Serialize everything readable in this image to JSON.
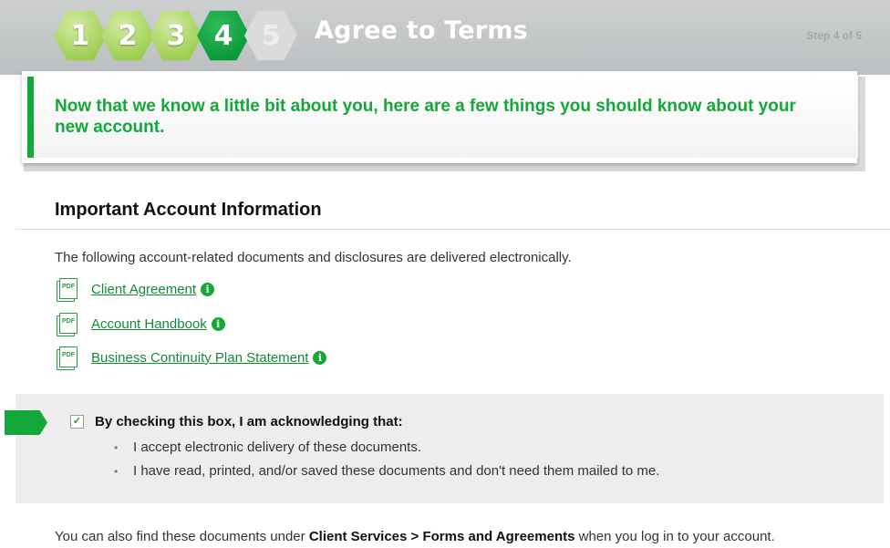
{
  "header": {
    "steps": [
      {
        "number": "1",
        "state": "done"
      },
      {
        "number": "2",
        "state": "done"
      },
      {
        "number": "3",
        "state": "done"
      },
      {
        "number": "4",
        "state": "current"
      },
      {
        "number": "5",
        "state": "future"
      }
    ],
    "title": "Agree to Terms",
    "step_indicator": "Step 4 of 5"
  },
  "intro": {
    "text": "Now that we know a little bit about you, here are a few things you should know about your new account."
  },
  "section": {
    "title": "Important Account Information",
    "description": "The following account-related documents and disclosures are delivered electronically.",
    "documents": [
      {
        "label": "Client Agreement",
        "icon": "pdf-icon",
        "info_icon": "info-icon"
      },
      {
        "label": "Account Handbook",
        "icon": "pdf-icon",
        "info_icon": "info-icon"
      },
      {
        "label": "Business Continuity Plan Statement",
        "icon": "pdf-icon",
        "info_icon": "info-icon"
      }
    ]
  },
  "acknowledgement": {
    "checked": true,
    "label": "By checking this box, I am acknowledging that:",
    "items": [
      "I accept electronic delivery of these documents.",
      "I have read, printed, and/or saved these documents and don't need them mailed to me."
    ]
  },
  "footer": {
    "prefix": "You can also find these documents under ",
    "path": "Client Services > Forms and Agreements",
    "suffix": " when you log in to your account."
  },
  "colors": {
    "accent_green": "#14a83a",
    "header_gray": "#c4c6c8",
    "done_step": "#9fcf52",
    "current_step": "#0c9a3c"
  }
}
